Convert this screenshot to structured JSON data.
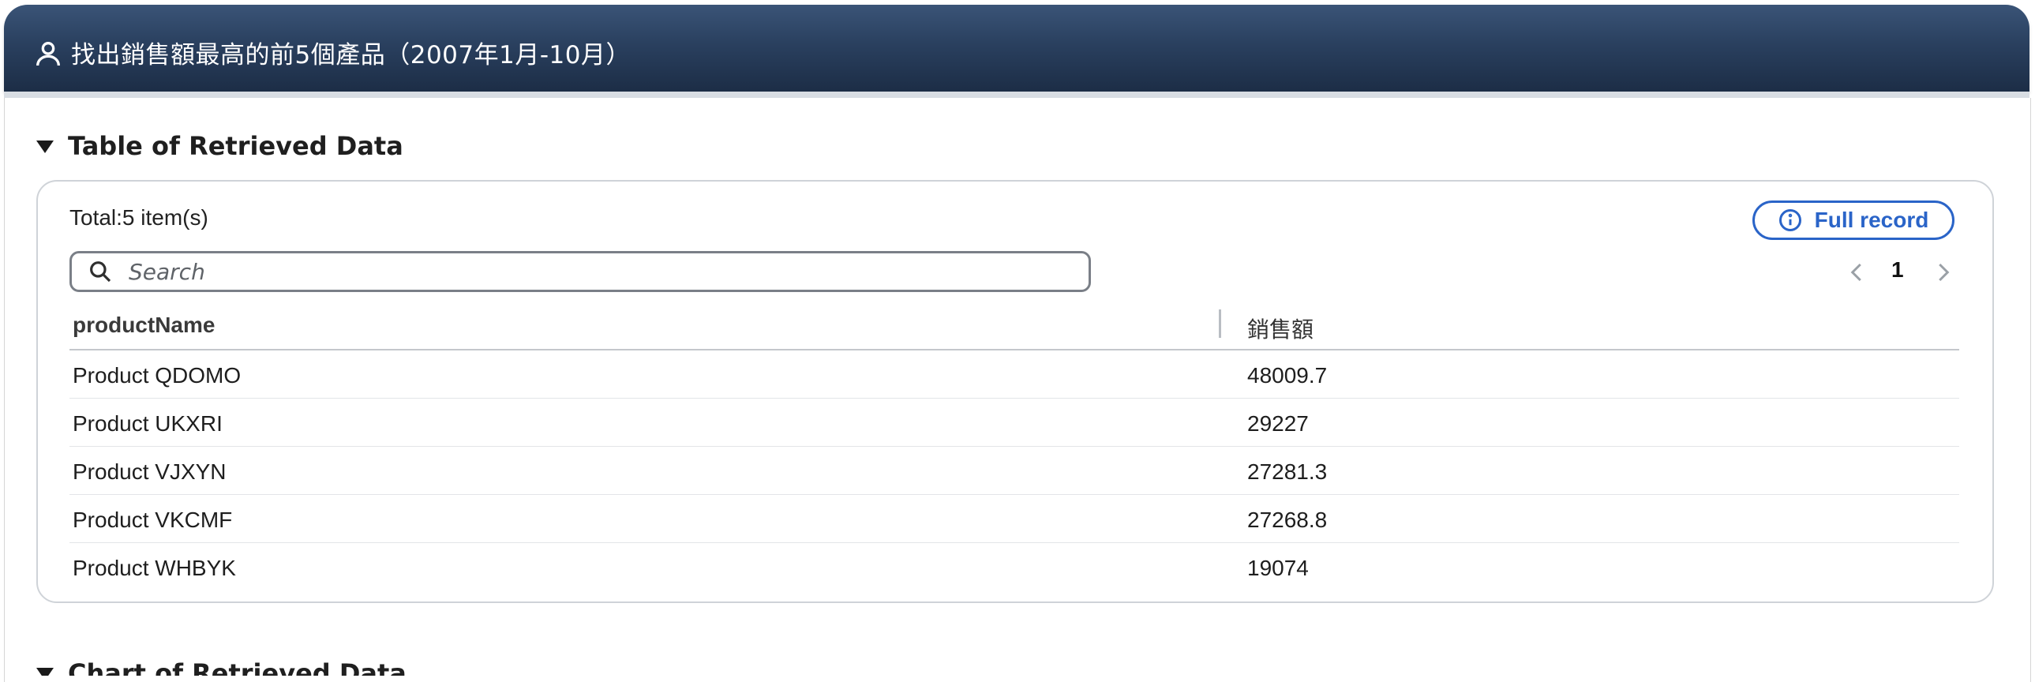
{
  "header": {
    "icon": "user-icon",
    "title": "找出銷售額最高的前5個產品（2007年1月-10月）"
  },
  "table_section": {
    "heading": "Table of Retrieved Data",
    "total_text": "Total:5 item(s)",
    "full_record_label": "Full record",
    "search_placeholder": "Search",
    "page_number": "1",
    "columns": [
      "productName",
      "銷售額"
    ],
    "rows": [
      {
        "productName": "Product QDOMO",
        "sales": "48009.7"
      },
      {
        "productName": "Product UKXRI",
        "sales": "29227"
      },
      {
        "productName": "Product VJXYN",
        "sales": "27281.3"
      },
      {
        "productName": "Product VKCMF",
        "sales": "27268.8"
      },
      {
        "productName": "Product WHBYK",
        "sales": "19074"
      }
    ]
  },
  "chart_section": {
    "heading": "Chart of Retrieved Data"
  },
  "colors": {
    "header_gradient_top": "#3a5477",
    "header_gradient_bottom": "#1c2d46",
    "accent": "#2a64c8"
  }
}
